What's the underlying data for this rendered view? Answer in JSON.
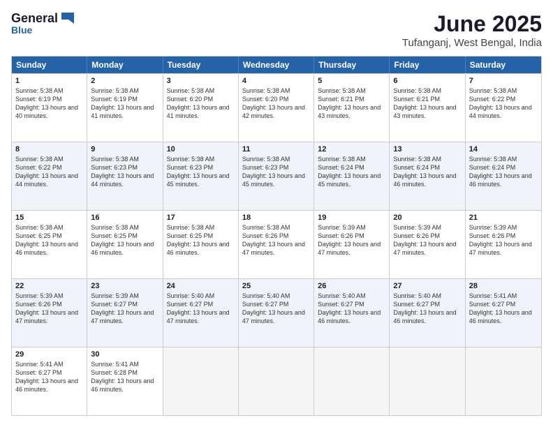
{
  "header": {
    "logo_general": "General",
    "logo_blue": "Blue",
    "month_title": "June 2025",
    "location": "Tufanganj, West Bengal, India"
  },
  "weekdays": [
    "Sunday",
    "Monday",
    "Tuesday",
    "Wednesday",
    "Thursday",
    "Friday",
    "Saturday"
  ],
  "rows": [
    {
      "alt": false,
      "cells": [
        {
          "day": "1",
          "sunrise": "5:38 AM",
          "sunset": "6:19 PM",
          "daylight": "13 hours and 40 minutes."
        },
        {
          "day": "2",
          "sunrise": "5:38 AM",
          "sunset": "6:19 PM",
          "daylight": "13 hours and 41 minutes."
        },
        {
          "day": "3",
          "sunrise": "5:38 AM",
          "sunset": "6:20 PM",
          "daylight": "13 hours and 41 minutes."
        },
        {
          "day": "4",
          "sunrise": "5:38 AM",
          "sunset": "6:20 PM",
          "daylight": "13 hours and 42 minutes."
        },
        {
          "day": "5",
          "sunrise": "5:38 AM",
          "sunset": "6:21 PM",
          "daylight": "13 hours and 43 minutes."
        },
        {
          "day": "6",
          "sunrise": "5:38 AM",
          "sunset": "6:21 PM",
          "daylight": "13 hours and 43 minutes."
        },
        {
          "day": "7",
          "sunrise": "5:38 AM",
          "sunset": "6:22 PM",
          "daylight": "13 hours and 44 minutes."
        }
      ]
    },
    {
      "alt": true,
      "cells": [
        {
          "day": "8",
          "sunrise": "5:38 AM",
          "sunset": "6:22 PM",
          "daylight": "13 hours and 44 minutes."
        },
        {
          "day": "9",
          "sunrise": "5:38 AM",
          "sunset": "6:23 PM",
          "daylight": "13 hours and 44 minutes."
        },
        {
          "day": "10",
          "sunrise": "5:38 AM",
          "sunset": "6:23 PM",
          "daylight": "13 hours and 45 minutes."
        },
        {
          "day": "11",
          "sunrise": "5:38 AM",
          "sunset": "6:23 PM",
          "daylight": "13 hours and 45 minutes."
        },
        {
          "day": "12",
          "sunrise": "5:38 AM",
          "sunset": "6:24 PM",
          "daylight": "13 hours and 45 minutes."
        },
        {
          "day": "13",
          "sunrise": "5:38 AM",
          "sunset": "6:24 PM",
          "daylight": "13 hours and 46 minutes."
        },
        {
          "day": "14",
          "sunrise": "5:38 AM",
          "sunset": "6:24 PM",
          "daylight": "13 hours and 46 minutes."
        }
      ]
    },
    {
      "alt": false,
      "cells": [
        {
          "day": "15",
          "sunrise": "5:38 AM",
          "sunset": "6:25 PM",
          "daylight": "13 hours and 46 minutes."
        },
        {
          "day": "16",
          "sunrise": "5:38 AM",
          "sunset": "6:25 PM",
          "daylight": "13 hours and 46 minutes."
        },
        {
          "day": "17",
          "sunrise": "5:38 AM",
          "sunset": "6:25 PM",
          "daylight": "13 hours and 46 minutes."
        },
        {
          "day": "18",
          "sunrise": "5:38 AM",
          "sunset": "6:26 PM",
          "daylight": "13 hours and 47 minutes."
        },
        {
          "day": "19",
          "sunrise": "5:39 AM",
          "sunset": "6:26 PM",
          "daylight": "13 hours and 47 minutes."
        },
        {
          "day": "20",
          "sunrise": "5:39 AM",
          "sunset": "6:26 PM",
          "daylight": "13 hours and 47 minutes."
        },
        {
          "day": "21",
          "sunrise": "5:39 AM",
          "sunset": "6:26 PM",
          "daylight": "13 hours and 47 minutes."
        }
      ]
    },
    {
      "alt": true,
      "cells": [
        {
          "day": "22",
          "sunrise": "5:39 AM",
          "sunset": "6:26 PM",
          "daylight": "13 hours and 47 minutes."
        },
        {
          "day": "23",
          "sunrise": "5:39 AM",
          "sunset": "6:27 PM",
          "daylight": "13 hours and 47 minutes."
        },
        {
          "day": "24",
          "sunrise": "5:40 AM",
          "sunset": "6:27 PM",
          "daylight": "13 hours and 47 minutes."
        },
        {
          "day": "25",
          "sunrise": "5:40 AM",
          "sunset": "6:27 PM",
          "daylight": "13 hours and 47 minutes."
        },
        {
          "day": "26",
          "sunrise": "5:40 AM",
          "sunset": "6:27 PM",
          "daylight": "13 hours and 46 minutes."
        },
        {
          "day": "27",
          "sunrise": "5:40 AM",
          "sunset": "6:27 PM",
          "daylight": "13 hours and 46 minutes."
        },
        {
          "day": "28",
          "sunrise": "5:41 AM",
          "sunset": "6:27 PM",
          "daylight": "13 hours and 46 minutes."
        }
      ]
    },
    {
      "alt": false,
      "cells": [
        {
          "day": "29",
          "sunrise": "5:41 AM",
          "sunset": "6:27 PM",
          "daylight": "13 hours and 46 minutes."
        },
        {
          "day": "30",
          "sunrise": "5:41 AM",
          "sunset": "6:28 PM",
          "daylight": "13 hours and 46 minutes."
        },
        {
          "day": "",
          "sunrise": "",
          "sunset": "",
          "daylight": ""
        },
        {
          "day": "",
          "sunrise": "",
          "sunset": "",
          "daylight": ""
        },
        {
          "day": "",
          "sunrise": "",
          "sunset": "",
          "daylight": ""
        },
        {
          "day": "",
          "sunrise": "",
          "sunset": "",
          "daylight": ""
        },
        {
          "day": "",
          "sunrise": "",
          "sunset": "",
          "daylight": ""
        }
      ]
    }
  ],
  "labels": {
    "sunrise": "Sunrise:",
    "sunset": "Sunset:",
    "daylight": "Daylight:"
  }
}
